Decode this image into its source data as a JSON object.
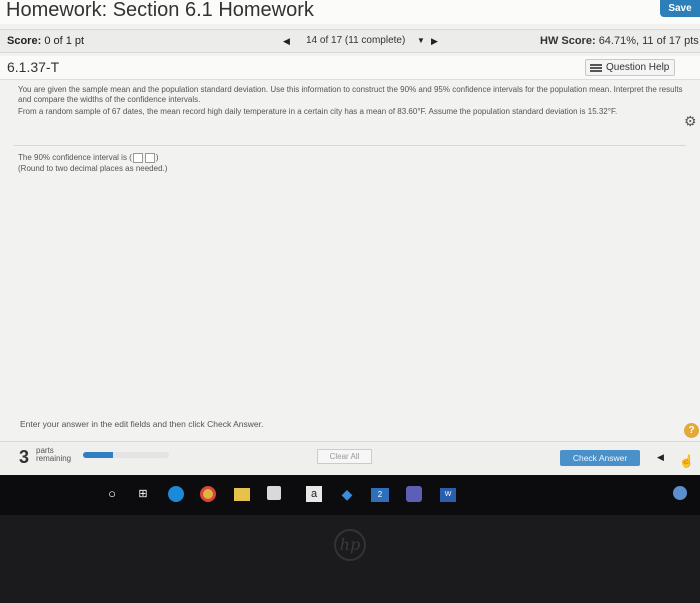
{
  "header": {
    "title": "Homework: Section 6.1 Homework",
    "save_label": "Save"
  },
  "score_bar": {
    "score_label": "Score:",
    "score_value": "0 of 1 pt",
    "question_nav": "14 of 17 (11 complete)",
    "hw_score_label": "HW Score:",
    "hw_score_value": "64.71%, 11 of 17 pts"
  },
  "question": {
    "id": "6.1.37-T",
    "help_label": "Question Help",
    "instructions": "You are given the sample mean and the population standard deviation. Use this information to construct the 90% and 95% confidence intervals for the population mean. Interpret the results and compare the widths of the confidence intervals.",
    "prompt": "From a random sample of 67 dates, the mean record high daily temperature in a certain city has a mean of 83.60°F. Assume the population standard deviation is 15.32°F.",
    "answer_line": "The 90% confidence interval is (",
    "answer_close": ")",
    "rounding_note": "(Round to two decimal places as needed.)"
  },
  "footer": {
    "hint": "Enter your answer in the edit fields and then click Check Answer.",
    "parts_count": "3",
    "parts_label_1": "parts",
    "parts_label_2": "remaining",
    "progress_fraction": 0.35,
    "clear_label": "Clear All",
    "check_label": "Check Answer"
  },
  "taskbar": {
    "icons": [
      "search-icon",
      "task-view-icon",
      "edge-icon",
      "chrome-icon",
      "file-explorer-icon",
      "store-icon",
      "amazon-icon",
      "dropbox-icon",
      "mail-icon",
      "teams-icon",
      "word-icon",
      "weather-icon"
    ],
    "amazon_glyph": "a",
    "mail_badge": "2",
    "word_glyph": "W"
  },
  "bezel": {
    "logo": "hp"
  }
}
